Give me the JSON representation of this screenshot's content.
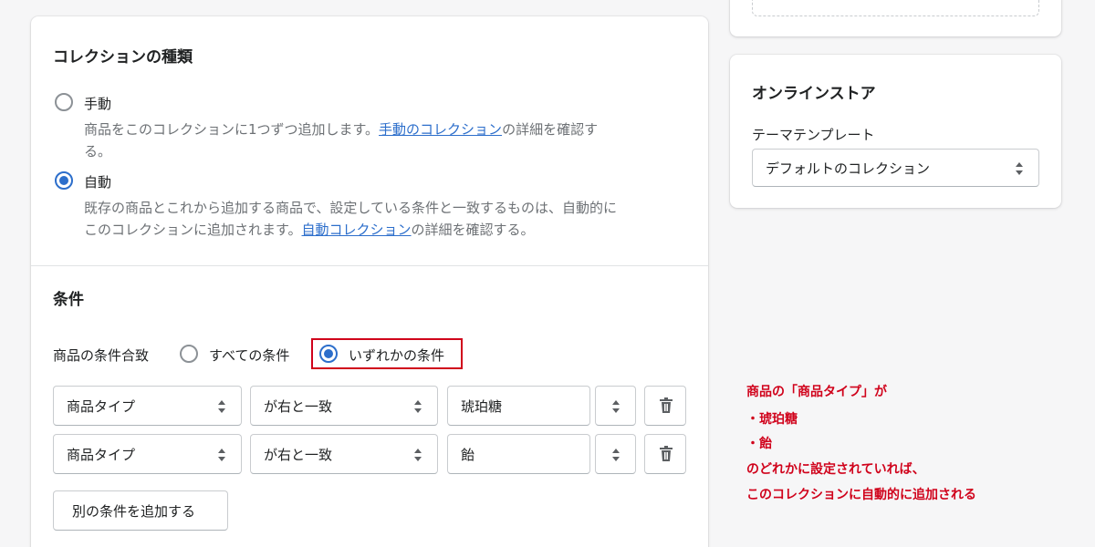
{
  "collection_type": {
    "heading": "コレクションの種類",
    "manual": {
      "label": "手動",
      "help_prefix": "商品をこのコレクションに1つずつ追加します。",
      "help_link": "手動のコレクション",
      "help_suffix": "の詳細を確認す",
      "help_line2": "る。",
      "selected": false
    },
    "automatic": {
      "label": "自動",
      "help_line1": "既存の商品とこれから追加する商品で、設定している条件と一致するものは、自動的に",
      "help_prefix": "このコレクションに追加されます。",
      "help_link": "自動コレクション",
      "help_suffix": "の詳細を確認する。",
      "selected": true
    }
  },
  "conditions": {
    "heading": "条件",
    "match_label": "商品の条件合致",
    "match_all": "すべての条件",
    "match_any": "いずれかの条件",
    "selected": "match_any",
    "rows": [
      {
        "field": "商品タイプ",
        "operator": "が右と一致",
        "value": "琥珀糖"
      },
      {
        "field": "商品タイプ",
        "operator": "が右と一致",
        "value": "飴"
      }
    ],
    "add_button": "別の条件を追加する"
  },
  "online_store": {
    "heading": "オンラインストア",
    "template_label": "テーマテンプレート",
    "template_value": "デフォルトのコレクション"
  },
  "annotation": {
    "lines": [
      "商品の「商品タイプ」が",
      "・琥珀糖",
      "・飴",
      "のどれかに設定されていれば、",
      "このコレクションに自動的に追加される"
    ]
  },
  "colors": {
    "accent": "#2c6ecb",
    "annotation_red": "#d0021b",
    "background": "#f6f6f7"
  }
}
